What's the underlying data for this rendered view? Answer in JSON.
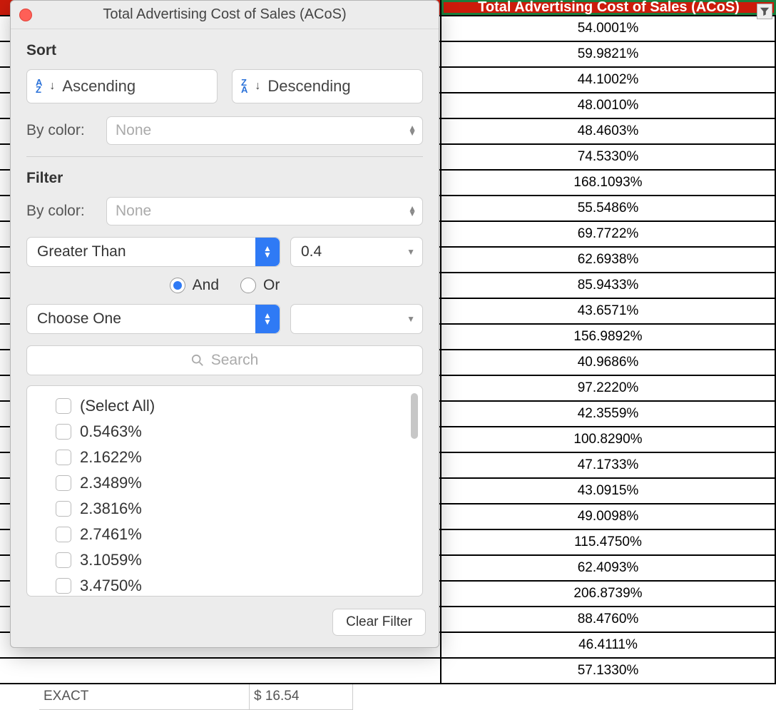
{
  "dialog": {
    "title": "Total Advertising Cost of Sales (ACoS)",
    "sort": {
      "section_label": "Sort",
      "ascending_label": "Ascending",
      "descending_label": "Descending",
      "by_color_label": "By color:",
      "by_color_value": "None"
    },
    "filter": {
      "section_label": "Filter",
      "by_color_label": "By color:",
      "by_color_value": "None",
      "cond1_operator": "Greater Than",
      "cond1_value": "0.4",
      "logic_and": "And",
      "logic_or": "Or",
      "logic_selected": "and",
      "cond2_operator": "Choose One",
      "cond2_value": "",
      "search_placeholder": "Search",
      "select_all_label": "(Select All)",
      "values": [
        "0.5463%",
        "2.1622%",
        "2.3489%",
        "2.3816%",
        "2.7461%",
        "3.1059%",
        "3.4750%"
      ],
      "clear_label": "Clear Filter"
    }
  },
  "column_header": "Total Advertising Cost of Sales (ACoS)",
  "column_values": [
    "54.0001%",
    "59.9821%",
    "44.1002%",
    "48.0010%",
    "48.4603%",
    "74.5330%",
    "168.1093%",
    "55.5486%",
    "69.7722%",
    "62.6938%",
    "85.9433%",
    "43.6571%",
    "156.9892%",
    "40.9686%",
    "97.2220%",
    "42.3559%",
    "100.8290%",
    "47.1733%",
    "43.0915%",
    "49.0098%",
    "115.4750%",
    "62.4093%",
    "206.8739%",
    "88.4760%",
    "46.4111%",
    "57.1330%"
  ],
  "peek_row": {
    "match_type": "EXACT",
    "price": "$ 16.54"
  }
}
